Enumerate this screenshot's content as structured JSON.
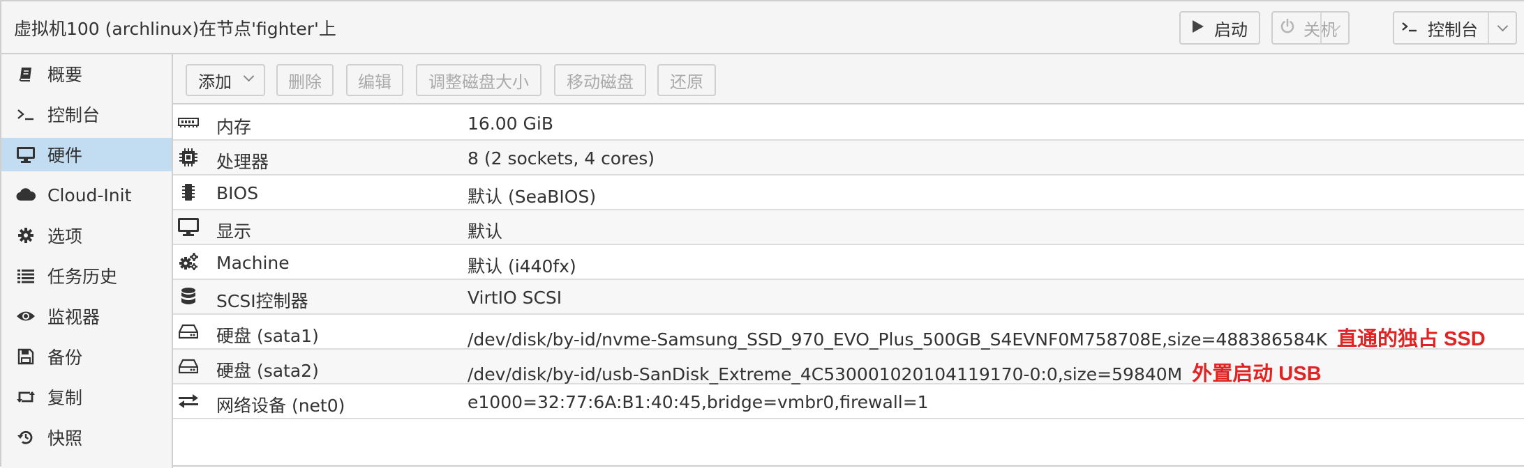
{
  "header": {
    "title": "虚拟机100 (archlinux)在节点'fighter'上",
    "start_label": "启动",
    "shutdown_label": "关机",
    "console_label": "控制台"
  },
  "sidebar": {
    "items": [
      {
        "label": "概要",
        "icon": "book-icon"
      },
      {
        "label": "控制台",
        "icon": "terminal-icon"
      },
      {
        "label": "硬件",
        "icon": "monitor-icon",
        "active": true
      },
      {
        "label": "Cloud-Init",
        "icon": "cloud-icon"
      },
      {
        "label": "选项",
        "icon": "gear-icon"
      },
      {
        "label": "任务历史",
        "icon": "list-icon"
      },
      {
        "label": "监视器",
        "icon": "eye-icon"
      },
      {
        "label": "备份",
        "icon": "floppy-icon"
      },
      {
        "label": "复制",
        "icon": "retweet-icon"
      },
      {
        "label": "快照",
        "icon": "history-icon"
      }
    ]
  },
  "toolbar": {
    "add_label": "添加",
    "remove_label": "删除",
    "edit_label": "编辑",
    "resize_label": "调整磁盘大小",
    "move_label": "移动磁盘",
    "revert_label": "还原"
  },
  "hardware": {
    "rows": [
      {
        "key": "内存",
        "value": "16.00 GiB",
        "icon": "memory-icon"
      },
      {
        "key": "处理器",
        "value": "8 (2 sockets, 4 cores)",
        "icon": "cpu-icon"
      },
      {
        "key": "BIOS",
        "value": "默认 (SeaBIOS)",
        "icon": "microchip-icon"
      },
      {
        "key": "显示",
        "value": "默认",
        "icon": "desktop-icon"
      },
      {
        "key": "Machine",
        "value": "默认 (i440fx)",
        "icon": "cogs-icon"
      },
      {
        "key": "SCSI控制器",
        "value": "VirtIO SCSI",
        "icon": "database-icon"
      },
      {
        "key": "硬盘 (sata1)",
        "value": "/dev/disk/by-id/nvme-Samsung_SSD_970_EVO_Plus_500GB_S4EVNF0M758708E,size=488386584K",
        "icon": "hdd-icon",
        "annotation": "直通的独占 SSD"
      },
      {
        "key": "硬盘 (sata2)",
        "value": "/dev/disk/by-id/usb-SanDisk_Extreme_4C530001020104119170-0:0,size=59840M",
        "icon": "hdd-icon",
        "annotation": "外置启动 USB"
      },
      {
        "key": "网络设备 (net0)",
        "value": "e1000=32:77:6A:B1:40:45,bridge=vmbr0,firewall=1",
        "icon": "exchange-icon"
      }
    ]
  },
  "colors": {
    "active_nav": "#c2ddf2",
    "annotation": "#e02424",
    "border": "#cfcfcf"
  }
}
